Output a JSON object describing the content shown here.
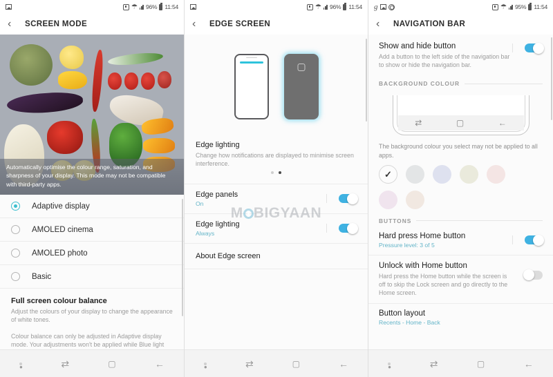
{
  "screens": [
    {
      "status": {
        "left_icons": [
          "image-icon"
        ],
        "alarm": "alarm-icon",
        "wifi": "wifi-icon",
        "signal": "signal-icon",
        "battery_pct": "96%",
        "battery": "battery-icon",
        "time": "11:54"
      },
      "title": "SCREEN MODE",
      "back": "‹",
      "photo_caption": "Automatically optimise the colour range, saturation, and sharpness of your display. This mode may not be compatible with third-party apps.",
      "options": [
        {
          "label": "Adaptive display",
          "selected": true
        },
        {
          "label": "AMOLED cinema",
          "selected": false
        },
        {
          "label": "AMOLED photo",
          "selected": false
        },
        {
          "label": "Basic",
          "selected": false
        }
      ],
      "balance_title": "Full screen colour balance",
      "balance_desc": "Adjust the colours of your display to change the appearance of white tones.",
      "balance_note": "Colour balance can only be adjusted in Adaptive display mode. Your adjustments won't be applied while Blue light filter is on."
    },
    {
      "status": {
        "left_icons": [
          "image-icon"
        ],
        "battery_pct": "96%",
        "time": "11:54"
      },
      "title": "EDGE SCREEN",
      "back": "‹",
      "feature_title": "Edge lighting",
      "feature_desc": "Change how notifications are displayed to minimise screen interference.",
      "watermark": "MOBIGYAAN",
      "rows": [
        {
          "title": "Edge panels",
          "sub": "On",
          "toggle": "on"
        },
        {
          "title": "Edge lighting",
          "sub": "Always",
          "toggle": "on"
        },
        {
          "title": "About Edge screen",
          "sub": "",
          "toggle": "none"
        }
      ]
    },
    {
      "status": {
        "left_icons": [
          "g-icon",
          "image-icon",
          "whatsapp-icon"
        ],
        "battery_pct": "95%",
        "time": "11:54"
      },
      "title": "NAVIGATION BAR",
      "back": "‹",
      "show_hide": {
        "title": "Show and hide button",
        "desc": "Add a button to the left side of the navigation bar to show or hide the navigation bar.",
        "toggle": "on"
      },
      "bg_colour_header": "BACKGROUND COLOUR",
      "bg_note": "The background colour you select may not be applied to all apps.",
      "swatches": [
        {
          "color": "#fcfcfc",
          "selected": true,
          "check": "✓"
        },
        {
          "color": "#e3e5e6",
          "selected": false
        },
        {
          "color": "#dee1ef",
          "selected": false
        },
        {
          "color": "#eaeadc",
          "selected": false
        },
        {
          "color": "#f4e5e4",
          "selected": false
        },
        {
          "color": "#f0e4ee",
          "selected": false
        },
        {
          "color": "#f1e8e1",
          "selected": false
        }
      ],
      "buttons_header": "BUTTONS",
      "button_rows": [
        {
          "title": "Hard press Home button",
          "sub": "Pressure level: 3 of 5",
          "desc": "",
          "toggle": "on"
        },
        {
          "title": "Unlock with Home button",
          "sub": "",
          "desc": "Hard press the Home button while the screen is off to skip the Lock screen and go directly to the Home screen.",
          "toggle": "off"
        },
        {
          "title": "Button layout",
          "sub": "Recents - Home - Back",
          "desc": "",
          "toggle": "none"
        }
      ]
    }
  ],
  "navbar": {
    "dot": "•",
    "recents": "⇄",
    "home": "▢",
    "back": "←"
  },
  "colors": {
    "accent_toggle": "#3fb2e2",
    "accent_radio": "#3dbfcf",
    "sub_text": "#63b4c8"
  }
}
